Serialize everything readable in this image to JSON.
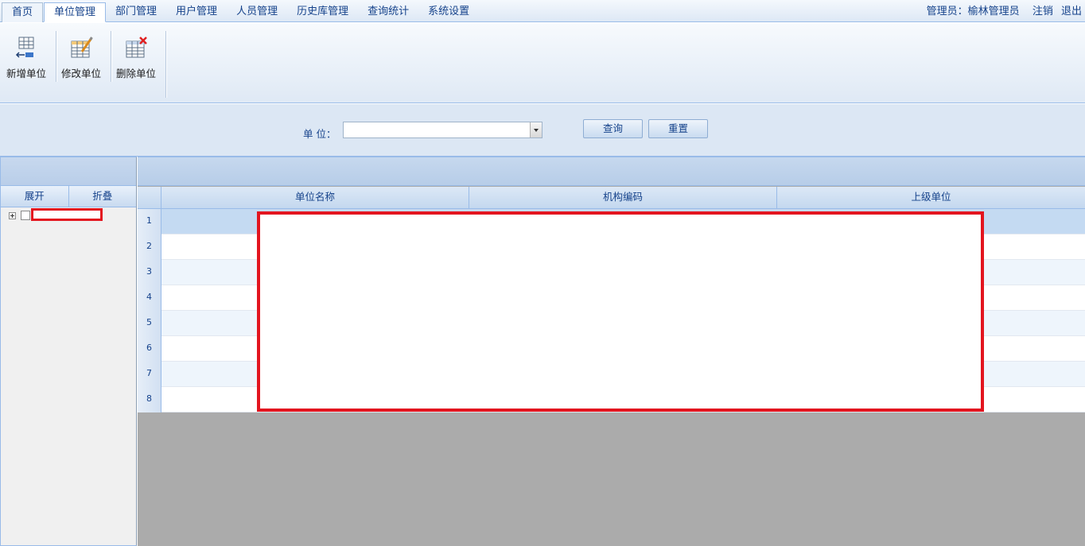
{
  "menu": {
    "tabs": [
      {
        "label": "首页"
      },
      {
        "label": "单位管理"
      },
      {
        "label": "部门管理"
      },
      {
        "label": "用户管理"
      },
      {
        "label": "人员管理"
      },
      {
        "label": "历史库管理"
      },
      {
        "label": "查询统计"
      },
      {
        "label": "系统设置"
      }
    ],
    "active_tab": "单位管理",
    "user_role": "管理员",
    "user_sep": "：",
    "user_name": "榆林管理员",
    "logout_label": "注销",
    "exit_label": "退出"
  },
  "toolbar": {
    "add_label": "新增单位",
    "edit_label": "修改单位",
    "delete_label": "删除单位"
  },
  "search": {
    "unit_label": "单 位：",
    "unit_value": "",
    "query_label": "查询",
    "reset_label": "重置"
  },
  "tree": {
    "expand_label": "展开",
    "collapse_label": "折叠"
  },
  "grid": {
    "columns": [
      "单位名称",
      "机构编码",
      "上级单位"
    ],
    "row_numbers": [
      "1",
      "2",
      "3",
      "4",
      "5",
      "6",
      "7",
      "8"
    ]
  },
  "colors": {
    "accent": "#15428b",
    "border": "#99bbe8",
    "redaction": "#e3151f",
    "grid_empty": "#ababab"
  }
}
